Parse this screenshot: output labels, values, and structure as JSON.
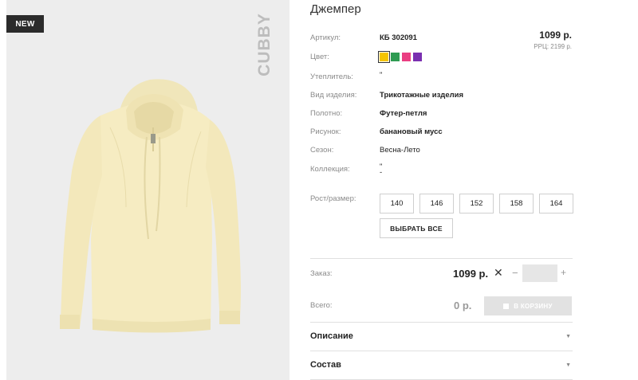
{
  "badge": "NEW",
  "brand": "CUBBY",
  "product": {
    "title": "Джемпер",
    "price": "1099 р.",
    "rrp": "РРЦ: 2199 р."
  },
  "attributes": {
    "article": {
      "label": "Артикул:",
      "value": "КБ 302091"
    },
    "color": {
      "label": "Цвет:"
    },
    "insulation": {
      "label": "Утеплитель:",
      "value": "\""
    },
    "type": {
      "label": "Вид изделия:",
      "value": "Трикотажные изделия"
    },
    "fabric": {
      "label": "Полотно:",
      "value": "Футер-петля"
    },
    "pattern": {
      "label": "Рисунок:",
      "value": "банановый мусс"
    },
    "season": {
      "label": "Сезон:",
      "value": "Весна-Лето"
    },
    "collection": {
      "label": "Коллекция:",
      "value": "\"",
      "value2": "-"
    },
    "size": {
      "label": "Рост/размер:"
    }
  },
  "swatch_colors": [
    "#f5c400",
    "#2e9b52",
    "#ea3e82",
    "#7a2fb0"
  ],
  "sizes": [
    "140",
    "146",
    "152",
    "158",
    "164"
  ],
  "select_all": "ВЫБРАТЬ ВСЕ",
  "order": {
    "label": "Заказ:",
    "price": "1099 р.",
    "times": "✕",
    "minus": "−",
    "plus": "+",
    "qty_value": ""
  },
  "total": {
    "label": "Всего:",
    "value": "0 р.",
    "cart_button": "В КОРЗИНУ"
  },
  "accordions": {
    "description": "Описание",
    "composition": "Состав"
  },
  "icons": {
    "accordion_arrow": "▼"
  }
}
